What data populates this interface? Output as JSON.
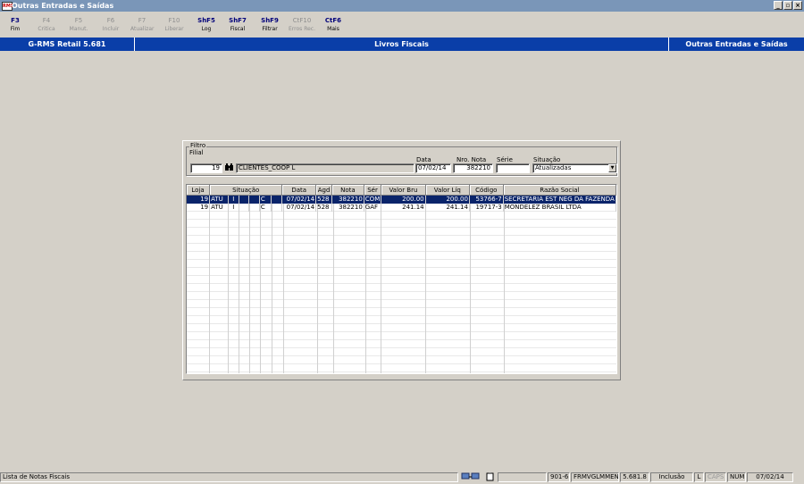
{
  "window": {
    "title": "Outras Entradas e Saídas",
    "app_icon": "RMS",
    "controls": [
      "_",
      "▫",
      "×"
    ]
  },
  "toolbar": [
    {
      "key": "F3",
      "label": "Fim",
      "enabled": true
    },
    {
      "key": "F4",
      "label": "Critica",
      "enabled": false
    },
    {
      "key": "F5",
      "label": "Manut.",
      "enabled": false
    },
    {
      "key": "F6",
      "label": "Incluir",
      "enabled": false
    },
    {
      "key": "F7",
      "label": "Atualizar",
      "enabled": false
    },
    {
      "key": "F10",
      "label": "Liberar",
      "enabled": false
    },
    {
      "key": "ShF5",
      "label": "Log",
      "enabled": true
    },
    {
      "key": "ShF7",
      "label": "Fiscal",
      "enabled": true
    },
    {
      "key": "ShF9",
      "label": "Filtrar",
      "enabled": true
    },
    {
      "key": "CtF10",
      "label": "Erros Rec.",
      "enabled": false
    },
    {
      "key": "CtF6",
      "label": "Mais",
      "enabled": true
    }
  ],
  "header": {
    "left": "G-RMS Retail 5.681",
    "center": "Livros Fiscais",
    "right": "Outras Entradas e Saídas",
    "color": "#0a3ea8"
  },
  "filter": {
    "group_label": "Filtro",
    "filial_label": "Filial",
    "filial_value": "19",
    "filial_name": "CLIENTES_COOP L",
    "data_label": "Data",
    "data_value": "07/02/14",
    "nota_label": "Nro. Nota",
    "nota_value": "382210",
    "serie_label": "Série",
    "serie_value": "",
    "situacao_label": "Situação",
    "situacao_value": "Atualizadas",
    "lookup_icon": "binoculars-icon"
  },
  "grid": {
    "columns": [
      "Loja",
      "Situação",
      "Data",
      "Agd",
      "Nota",
      "Sér",
      "Valor Bru",
      "Valor Líq",
      "Código",
      "Razão Social"
    ],
    "rows": [
      {
        "loja": "19",
        "s1": "ATU",
        "s2": "I",
        "s3": "",
        "s4": "",
        "s5": "C",
        "data": "07/02/14",
        "agd": "528",
        "nota": "382210",
        "ser": "COM",
        "valor_bru": "200.00",
        "valor_liq": "200.00",
        "codigo": "53766-7",
        "razao": "SECRETARIA EST NEG DA FAZENDA",
        "selected": true
      },
      {
        "loja": "19",
        "s1": "ATU",
        "s2": "I",
        "s3": "",
        "s4": "",
        "s5": "C",
        "data": "07/02/14",
        "agd": "528",
        "nota": "382210",
        "ser": "GAF",
        "valor_bru": "241.14",
        "valor_liq": "241.14",
        "codigo": "19717-3",
        "razao": "MONDELEZ BRASIL LTDA",
        "selected": false
      }
    ],
    "selection_color": "#0a246a"
  },
  "statusbar": {
    "message": "Lista de Notas Fiscais",
    "code": "901-6",
    "program": "FRMVGLMMENU",
    "version": "5.681.8",
    "mode": "Inclusão",
    "l": "L",
    "caps": "CAPS",
    "num": "NUM",
    "date": "07/02/14",
    "icons": [
      "network-icon",
      "clipboard-icon"
    ]
  }
}
